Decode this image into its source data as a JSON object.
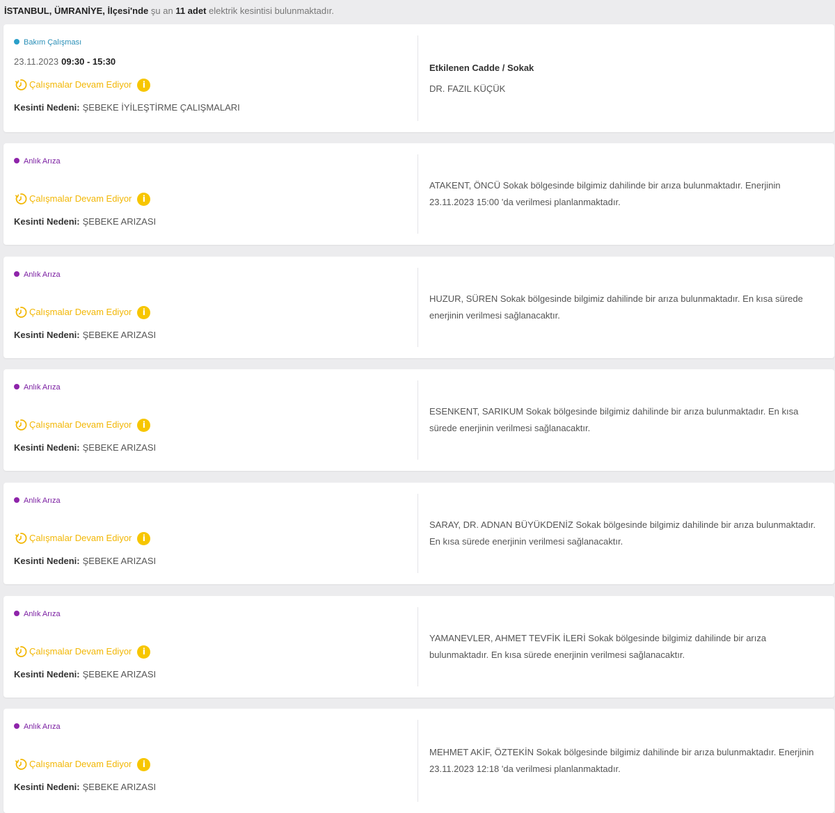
{
  "summary": {
    "location": "İSTANBUL, ÜMRANİYE, İlçesi'nde",
    "prefix": "şu an",
    "count": "11 adet",
    "suffix": "elektrik kesintisi bulunmaktadır."
  },
  "colors": {
    "maintenance": "#2a9fc9",
    "fault": "#8e24aa",
    "status": "#f2b705",
    "info_badge": "#f7c600"
  },
  "outages": [
    {
      "type": "Bakım Çalışması",
      "date": "23.11.2023",
      "time": "09:30 - 15:30",
      "status": "Çalışmalar Devam Ediyor",
      "reason_label": "Kesinti Nedeni:",
      "reason": "ŞEBEKE İYİLEŞTİRME ÇALIŞMALARI",
      "affected_title": "Etkilenen Cadde / Sokak",
      "affected_street": "DR. FAZIL KÜÇÜK"
    },
    {
      "type": "Anlık Arıza",
      "status": "Çalışmalar Devam Ediyor",
      "reason_label": "Kesinti Nedeni:",
      "reason": "ŞEBEKE ARIZASI",
      "message": "ATAKENT, ÖNCÜ Sokak bölgesinde bilgimiz dahilinde bir arıza bulunmaktadır. Enerjinin 23.11.2023 15:00 'da verilmesi planlanmaktadır."
    },
    {
      "type": "Anlık Arıza",
      "status": "Çalışmalar Devam Ediyor",
      "reason_label": "Kesinti Nedeni:",
      "reason": "ŞEBEKE ARIZASI",
      "message": "HUZUR, SÜREN Sokak bölgesinde bilgimiz dahilinde bir arıza bulunmaktadır. En kısa sürede enerjinin verilmesi sağlanacaktır."
    },
    {
      "type": "Anlık Arıza",
      "status": "Çalışmalar Devam Ediyor",
      "reason_label": "Kesinti Nedeni:",
      "reason": "ŞEBEKE ARIZASI",
      "message": "ESENKENT, SARIKUM Sokak bölgesinde bilgimiz dahilinde bir arıza bulunmaktadır. En kısa sürede enerjinin verilmesi sağlanacaktır."
    },
    {
      "type": "Anlık Arıza",
      "status": "Çalışmalar Devam Ediyor",
      "reason_label": "Kesinti Nedeni:",
      "reason": "ŞEBEKE ARIZASI",
      "message": "SARAY, DR. ADNAN BÜYÜKDENİZ Sokak bölgesinde bilgimiz dahilinde bir arıza bulunmaktadır. En kısa sürede enerjinin verilmesi sağlanacaktır."
    },
    {
      "type": "Anlık Arıza",
      "status": "Çalışmalar Devam Ediyor",
      "reason_label": "Kesinti Nedeni:",
      "reason": "ŞEBEKE ARIZASI",
      "message": "YAMANEVLER, AHMET TEVFİK İLERİ Sokak bölgesinde bilgimiz dahilinde bir arıza bulunmaktadır. En kısa sürede enerjinin verilmesi sağlanacaktır."
    },
    {
      "type": "Anlık Arıza",
      "status": "Çalışmalar Devam Ediyor",
      "reason_label": "Kesinti Nedeni:",
      "reason": "ŞEBEKE ARIZASI",
      "message": "MEHMET AKİF, ÖZTEKİN Sokak bölgesinde bilgimiz dahilinde bir arıza bulunmaktadır. Enerjinin 23.11.2023 12:18 'da verilmesi planlanmaktadır."
    }
  ]
}
